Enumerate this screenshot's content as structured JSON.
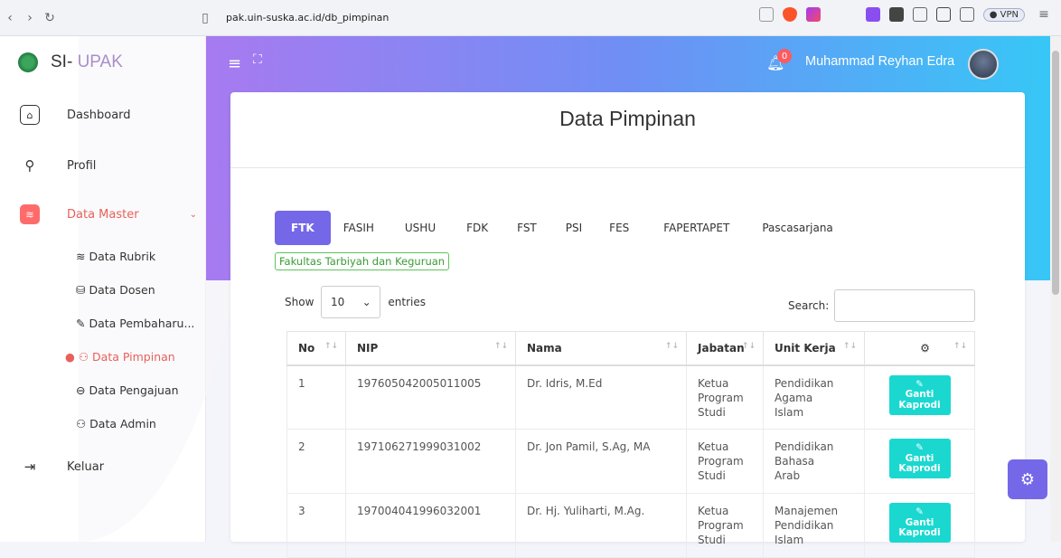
{
  "browser": {
    "url": "pak.uin-suska.ac.id/db_pimpinan",
    "vpn_label": "VPN"
  },
  "sidebar": {
    "brand_prefix": "SI- ",
    "brand_accent": "UPAK",
    "items": [
      {
        "label": "Dashboard",
        "icon": "home-icon"
      },
      {
        "label": "Profil",
        "icon": "user-icon"
      },
      {
        "label": "Data Master",
        "icon": "layers-icon"
      },
      {
        "label": "Keluar",
        "icon": "logout-icon"
      }
    ],
    "sub_items": [
      {
        "label": "≋ Data Rubrik"
      },
      {
        "label": "⛁ Data Dosen"
      },
      {
        "label": "✎ Data Pembaharu..."
      },
      {
        "label": "● ⚇ Data Pimpinan"
      },
      {
        "label": "⊖ Data Pengajuan"
      },
      {
        "label": "⚇ Data Admin"
      }
    ]
  },
  "header": {
    "notif_count": "0",
    "user_name": "Muhammad Reyhan Edra"
  },
  "card": {
    "title": "Data Pimpinan",
    "tabs": [
      "FTK",
      "FASIH",
      "USHU",
      "FDK",
      "FST",
      "PSI",
      "FES",
      "FAPERTAPET",
      "Pascasarjana"
    ],
    "tab_description": "Fakultas Tarbiyah dan Keguruan",
    "show_label": "Show",
    "entries_value": "10",
    "entries_label": "entries",
    "search_label": "Search:"
  },
  "table": {
    "headers": [
      "No",
      "NIP",
      "Nama",
      "Jabatan",
      "Unit Kerja"
    ],
    "action_label_1": "Ganti",
    "action_label_2": "Kaprodi",
    "rows": [
      {
        "no": "1",
        "nip": "197605042005011005",
        "nama": "Dr. Idris, M.Ed",
        "jabatan": [
          "Ketua",
          "Program",
          "Studi"
        ],
        "unit": [
          "Pendidikan",
          "Agama",
          "Islam"
        ]
      },
      {
        "no": "2",
        "nip": "197106271999031002",
        "nama": "Dr. Jon Pamil, S.Ag, MA",
        "jabatan": [
          "Ketua",
          "Program",
          "Studi"
        ],
        "unit": [
          "Pendidikan",
          "Bahasa",
          "Arab"
        ]
      },
      {
        "no": "3",
        "nip": "197004041996032001",
        "nama": "Dr. Hj. Yuliharti, M.Ag.",
        "jabatan": [
          "Ketua",
          "Program",
          "Studi"
        ],
        "unit": [
          "Manajemen",
          "Pendidikan",
          "Islam"
        ]
      }
    ]
  },
  "colors": {
    "accent": "#7468e8",
    "danger": "#e8605a",
    "cyan_button": "#1ad8d0"
  }
}
